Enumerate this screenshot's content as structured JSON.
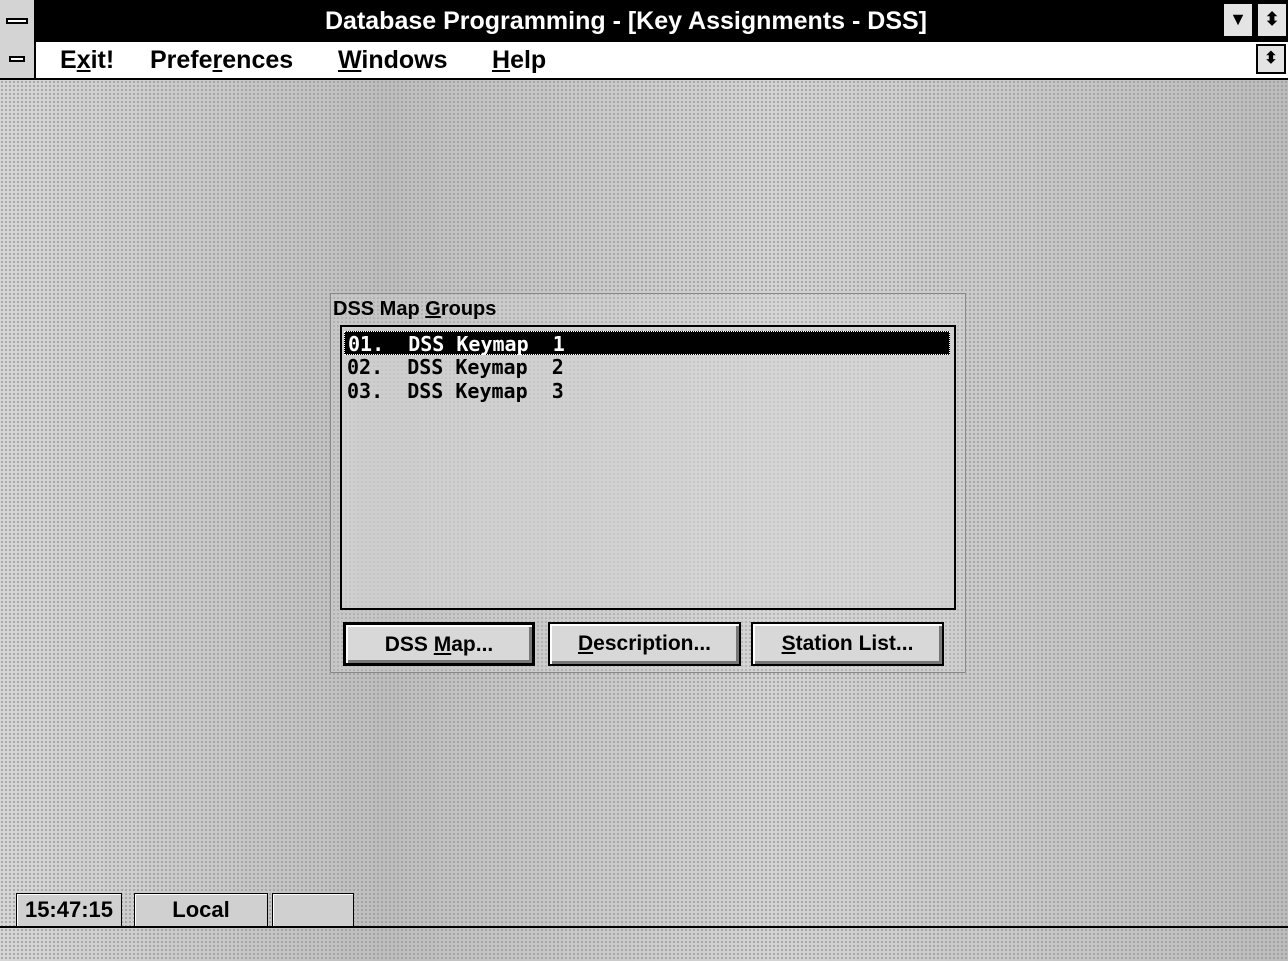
{
  "window": {
    "title": "Database Programming - [Key Assignments - DSS]",
    "minimize_glyph": "▼",
    "maxrestore_glyph": "⬍"
  },
  "menubar": {
    "items": [
      {
        "pre": "E",
        "u": "x",
        "post": "it!"
      },
      {
        "pre": "Prefe",
        "u": "r",
        "post": "ences"
      },
      {
        "pre": "",
        "u": "W",
        "post": "indows"
      },
      {
        "pre": "",
        "u": "H",
        "post": "elp"
      }
    ],
    "restore_glyph": "⬍"
  },
  "dialog": {
    "group_label": {
      "pre": "DSS Map ",
      "u": "G",
      "post": "roups"
    },
    "list_items": [
      "01.  DSS Keymap  1",
      "02.  DSS Keymap  2",
      "03.  DSS Keymap  3"
    ],
    "selected_index": 0,
    "buttons": [
      {
        "pre": "DSS ",
        "u": "M",
        "post": "ap..."
      },
      {
        "pre": "",
        "u": "D",
        "post": "escription..."
      },
      {
        "pre": "",
        "u": "S",
        "post": "tation List..."
      }
    ]
  },
  "status": {
    "time": "15:47:15",
    "mode": "Local",
    "cell3": ""
  }
}
